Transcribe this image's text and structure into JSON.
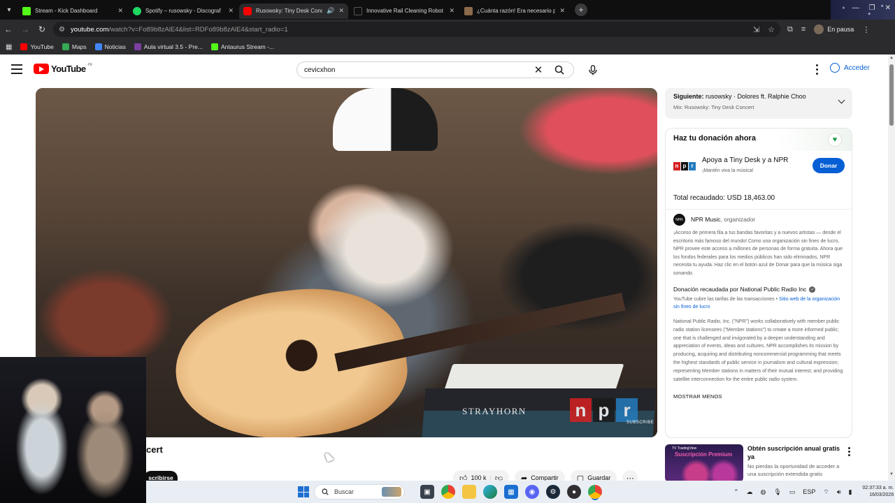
{
  "browser": {
    "tabs": [
      {
        "title": "Stream - Kick Dashboard",
        "color": "#53fc18",
        "active": false
      },
      {
        "title": "Spotify – rusowsky - Discograf",
        "color": "#1ed760",
        "active": false
      },
      {
        "title": "Rusowsky: Tiny Desk Conc",
        "color": "#ff0000",
        "active": true
      },
      {
        "title": "Innovative Rail Cleaning Robot",
        "color": "#111111",
        "active": false
      },
      {
        "title": "¿Cuánta razón! Era necesario p",
        "color": "#8a6a4a",
        "active": false
      }
    ],
    "url_host": "youtube.com",
    "url_path": "/watch?v=Fo89b8zAlE4&list=RDFo89b8zAlE4&start_radio=1",
    "profile_label": "En pausa",
    "bookmarks": [
      {
        "label": "YouTube",
        "color": "#ff0000"
      },
      {
        "label": "Maps",
        "color": "#34a853"
      },
      {
        "label": "Noticias",
        "color": "#4285f4"
      },
      {
        "label": "Aula virtual 3.5 - Pre...",
        "color": "#7b3fa0"
      },
      {
        "label": "Antaurus Stream -...",
        "color": "#53fc18"
      }
    ]
  },
  "youtube": {
    "logo_text": "YouTube",
    "logo_region": "PE",
    "search_value": "cevicxhon",
    "signin_label": "Acceder",
    "video_title_partial": "cert",
    "subscribe_partial": "scribirse",
    "book_title": "STRAYHORN",
    "watermark_sub": "SUBSCRIBE",
    "actions": {
      "likes": "100 k",
      "share": "Compartir",
      "save": "Guardar"
    }
  },
  "up_next": {
    "label": "Siguiente:",
    "title": "rusowsky · Dolores ft. Ralphie Choo",
    "mix": "Mix: Rusowsky: Tiny Desk Concert"
  },
  "donation": {
    "heading": "Haz tu donación ahora",
    "org_title": "Apoya a Tiny Desk y a NPR",
    "org_sub": "¡Mantén viva la música!",
    "donate_label": "Donar",
    "raised": "Total recaudado: USD 18,463.00",
    "organizer_name": "NPR Music",
    "organizer_role": ", organizador",
    "description": "¡Acceso de primera fila a tus bandas favoritas y a nuevos artistas — desde el escritorio más famoso del mundo! Como una organización sin fines de lucro, NPR provee este acceso a millones de personas de forma gratuita. Ahora que los fondos federales para los medios públicos han sido eliminados, NPR necesita tu ayuda. Haz clic en el botón azul de Donar para que la música siga sonando.",
    "collected_by": "Donación recaudada por National Public Radio Inc",
    "fees_text": "YouTube cubre las tarifas de las transacciones",
    "fees_link": "Sitio web de la organización sin fines de lucro",
    "about": "National Public Radio, Inc. (\"NPR\") works collaboratively with member public radio station licensees (\"Member stations\") to create a more informed public; one that is challenged and invigorated by a deeper understanding and appreciation of events, ideas and cultures. NPR accomplishes its mission by producing, acquiring and distributing noncommercial programming that meets the highest standards of public service in journalism and cultural expression; representing Member stations in matters of their mutual interest; and providing satellite interconnection for the entire public radio system.",
    "show_less": "MOSTRAR MENOS"
  },
  "ad": {
    "title": "Obtén suscripción anual gratis ya",
    "description": "No pierdas la oportunidad de acceder a una suscripción extendida gratis",
    "thumb_label": "TV TradingView",
    "thumb_title": "Suscripción Premium"
  },
  "taskbar": {
    "search_placeholder": "Buscar",
    "language": "ESP",
    "time": "02:37:33 a. m.",
    "date": "16/03/2026"
  }
}
